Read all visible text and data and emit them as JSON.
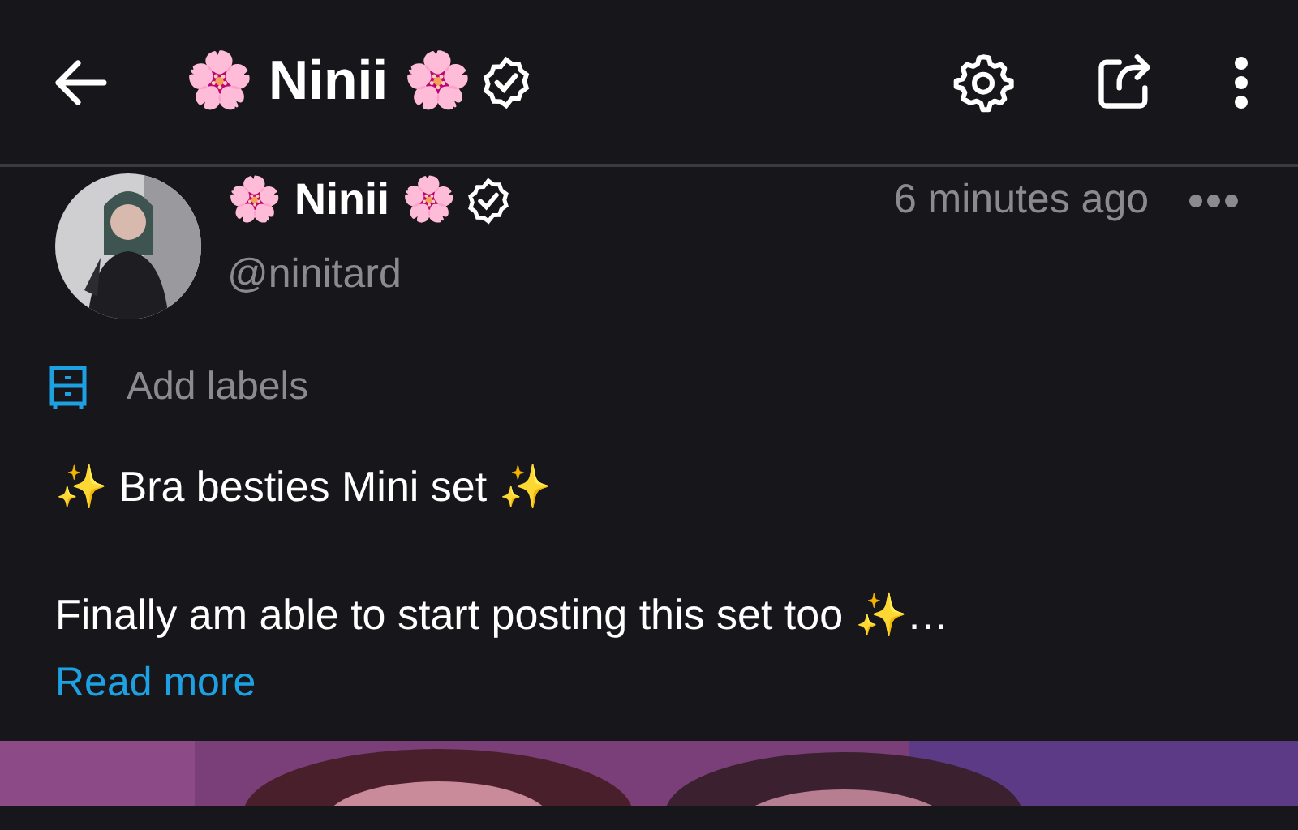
{
  "header": {
    "title": "🌸 Ninii 🌸",
    "verified": true
  },
  "post": {
    "author": {
      "name": "🌸 Ninii 🌸",
      "verified": true,
      "handle": "@ninitard"
    },
    "time": "6 minutes ago",
    "labels_action": "Add labels",
    "text_lines": [
      "✨ Bra besties Mini set ✨",
      "Finally am able to start posting this set too ✨…"
    ],
    "read_more": "Read more"
  }
}
